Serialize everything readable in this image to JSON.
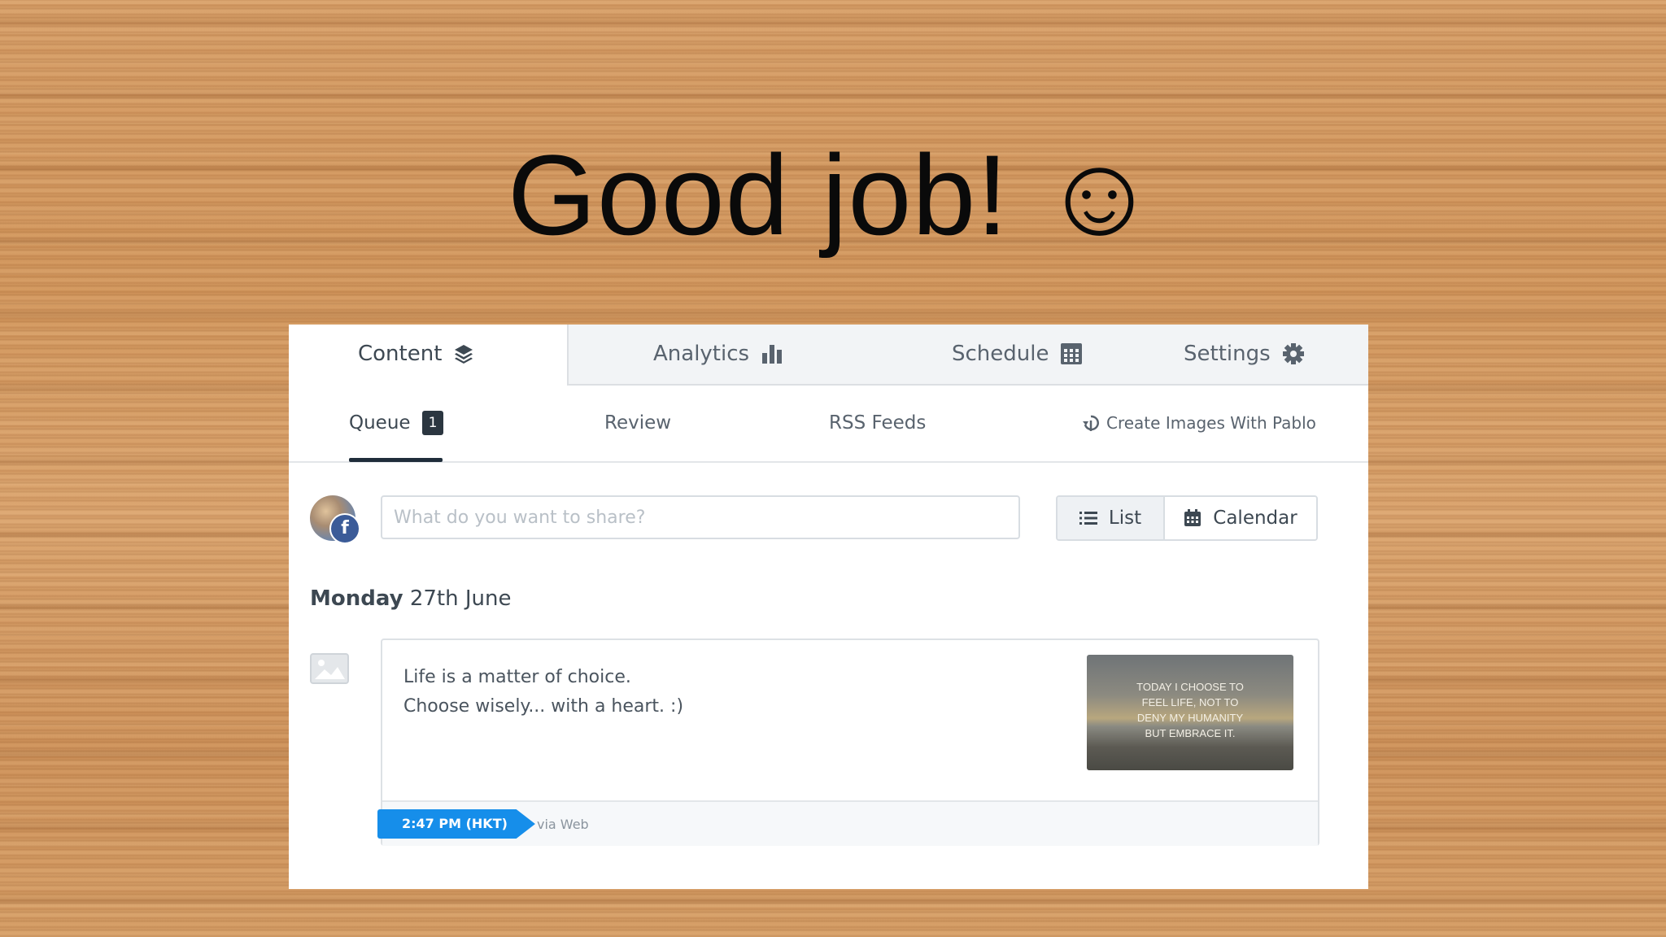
{
  "slide": {
    "title": "Good job! ☺"
  },
  "nav": {
    "tabs": [
      {
        "label": "Content",
        "icon": "layers-icon"
      },
      {
        "label": "Analytics",
        "icon": "bar-chart-icon"
      },
      {
        "label": "Schedule",
        "icon": "calendar-grid-icon"
      },
      {
        "label": "Settings",
        "icon": "gear-icon"
      }
    ],
    "active_tab": "Content"
  },
  "subnav": {
    "queue_label": "Queue",
    "queue_count": "1",
    "review_label": "Review",
    "rss_label": "RSS Feeds",
    "pablo_label": "Create Images With Pablo"
  },
  "composer": {
    "placeholder": "What do you want to share?",
    "list_label": "List",
    "calendar_label": "Calendar",
    "active_view": "List"
  },
  "queue": {
    "day_name": "Monday",
    "date": "27th June",
    "post": {
      "lines": [
        "Life is a matter of choice.",
        "Choose wisely... with a heart. :)"
      ],
      "image_quote": [
        "TODAY I CHOOSE TO",
        "FEEL LIFE, NOT TO",
        "DENY MY HUMANITY",
        "BUT EMBRACE IT."
      ],
      "time": "2:47 PM (HKT)",
      "via": "via Web"
    }
  },
  "colors": {
    "accent": "#168eea",
    "facebook": "#3b5b98",
    "badge_dark": "#2b3640"
  }
}
